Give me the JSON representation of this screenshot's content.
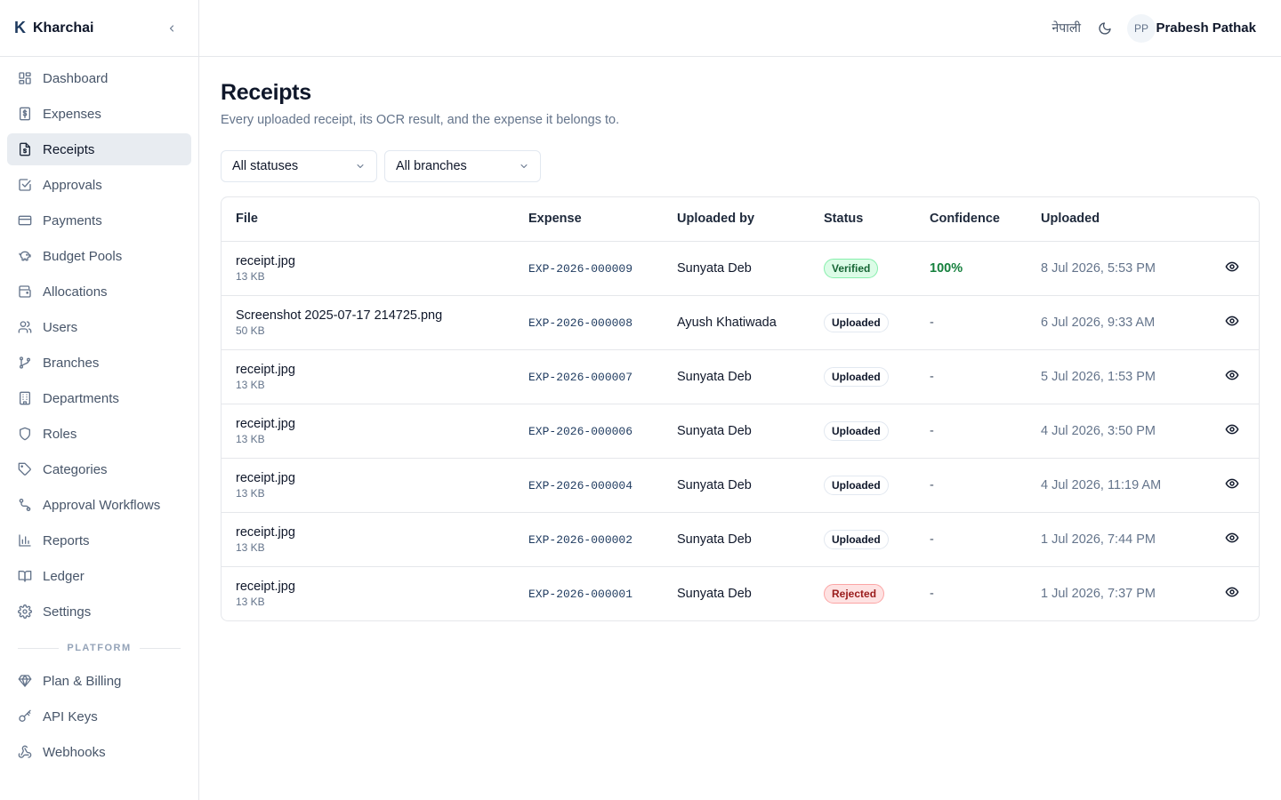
{
  "brand": {
    "letter": "K",
    "name": "Kharchai"
  },
  "sidebar": {
    "items": [
      {
        "label": "Dashboard",
        "icon": "grid-icon"
      },
      {
        "label": "Expenses",
        "icon": "receipt-dollar-icon"
      },
      {
        "label": "Receipts",
        "icon": "file-receipt-icon",
        "active": true
      },
      {
        "label": "Approvals",
        "icon": "check-square-icon"
      },
      {
        "label": "Payments",
        "icon": "credit-card-icon"
      },
      {
        "label": "Budget Pools",
        "icon": "piggy-bank-icon"
      },
      {
        "label": "Allocations",
        "icon": "wallet-icon"
      },
      {
        "label": "Users",
        "icon": "users-icon"
      },
      {
        "label": "Branches",
        "icon": "git-branch-icon"
      },
      {
        "label": "Departments",
        "icon": "building-icon"
      },
      {
        "label": "Roles",
        "icon": "shield-icon"
      },
      {
        "label": "Categories",
        "icon": "tag-icon"
      },
      {
        "label": "Approval Workflows",
        "icon": "workflow-icon"
      },
      {
        "label": "Reports",
        "icon": "bar-chart-icon"
      },
      {
        "label": "Ledger",
        "icon": "book-icon"
      },
      {
        "label": "Settings",
        "icon": "gear-icon"
      }
    ],
    "section_label": "PLATFORM",
    "platform_items": [
      {
        "label": "Plan & Billing",
        "icon": "gem-icon"
      },
      {
        "label": "API Keys",
        "icon": "key-icon"
      },
      {
        "label": "Webhooks",
        "icon": "webhook-icon"
      }
    ]
  },
  "header": {
    "language": "नेपाली",
    "avatar_initials": "PP",
    "user_name": "Prabesh Pathak"
  },
  "page": {
    "title": "Receipts",
    "subtitle": "Every uploaded receipt, its OCR result, and the expense it belongs to."
  },
  "filters": {
    "status": "All statuses",
    "branch": "All branches"
  },
  "table": {
    "columns": [
      "File",
      "Expense",
      "Uploaded by",
      "Status",
      "Confidence",
      "Uploaded"
    ],
    "rows": [
      {
        "file": "receipt.jpg",
        "size": "13 KB",
        "expense": "EXP-2026-000009",
        "uploaded_by": "Sunyata Deb",
        "status": "Verified",
        "confidence": "100%",
        "uploaded": "8 Jul 2026, 5:53 PM"
      },
      {
        "file": "Screenshot 2025-07-17 214725.png",
        "size": "50 KB",
        "expense": "EXP-2026-000008",
        "uploaded_by": "Ayush Khatiwada",
        "status": "Uploaded",
        "confidence": "-",
        "uploaded": "6 Jul 2026, 9:33 AM"
      },
      {
        "file": "receipt.jpg",
        "size": "13 KB",
        "expense": "EXP-2026-000007",
        "uploaded_by": "Sunyata Deb",
        "status": "Uploaded",
        "confidence": "-",
        "uploaded": "5 Jul 2026, 1:53 PM"
      },
      {
        "file": "receipt.jpg",
        "size": "13 KB",
        "expense": "EXP-2026-000006",
        "uploaded_by": "Sunyata Deb",
        "status": "Uploaded",
        "confidence": "-",
        "uploaded": "4 Jul 2026, 3:50 PM"
      },
      {
        "file": "receipt.jpg",
        "size": "13 KB",
        "expense": "EXP-2026-000004",
        "uploaded_by": "Sunyata Deb",
        "status": "Uploaded",
        "confidence": "-",
        "uploaded": "4 Jul 2026, 11:19 AM"
      },
      {
        "file": "receipt.jpg",
        "size": "13 KB",
        "expense": "EXP-2026-000002",
        "uploaded_by": "Sunyata Deb",
        "status": "Uploaded",
        "confidence": "-",
        "uploaded": "1 Jul 2026, 7:44 PM"
      },
      {
        "file": "receipt.jpg",
        "size": "13 KB",
        "expense": "EXP-2026-000001",
        "uploaded_by": "Sunyata Deb",
        "status": "Rejected",
        "confidence": "-",
        "uploaded": "1 Jul 2026, 7:37 PM"
      }
    ]
  },
  "colors": {
    "active_nav_bg": "#e8ecf1",
    "verified": "#166534",
    "rejected": "#991b1b",
    "confidence_good": "#15803d",
    "expense_link": "#1e3a5f"
  }
}
